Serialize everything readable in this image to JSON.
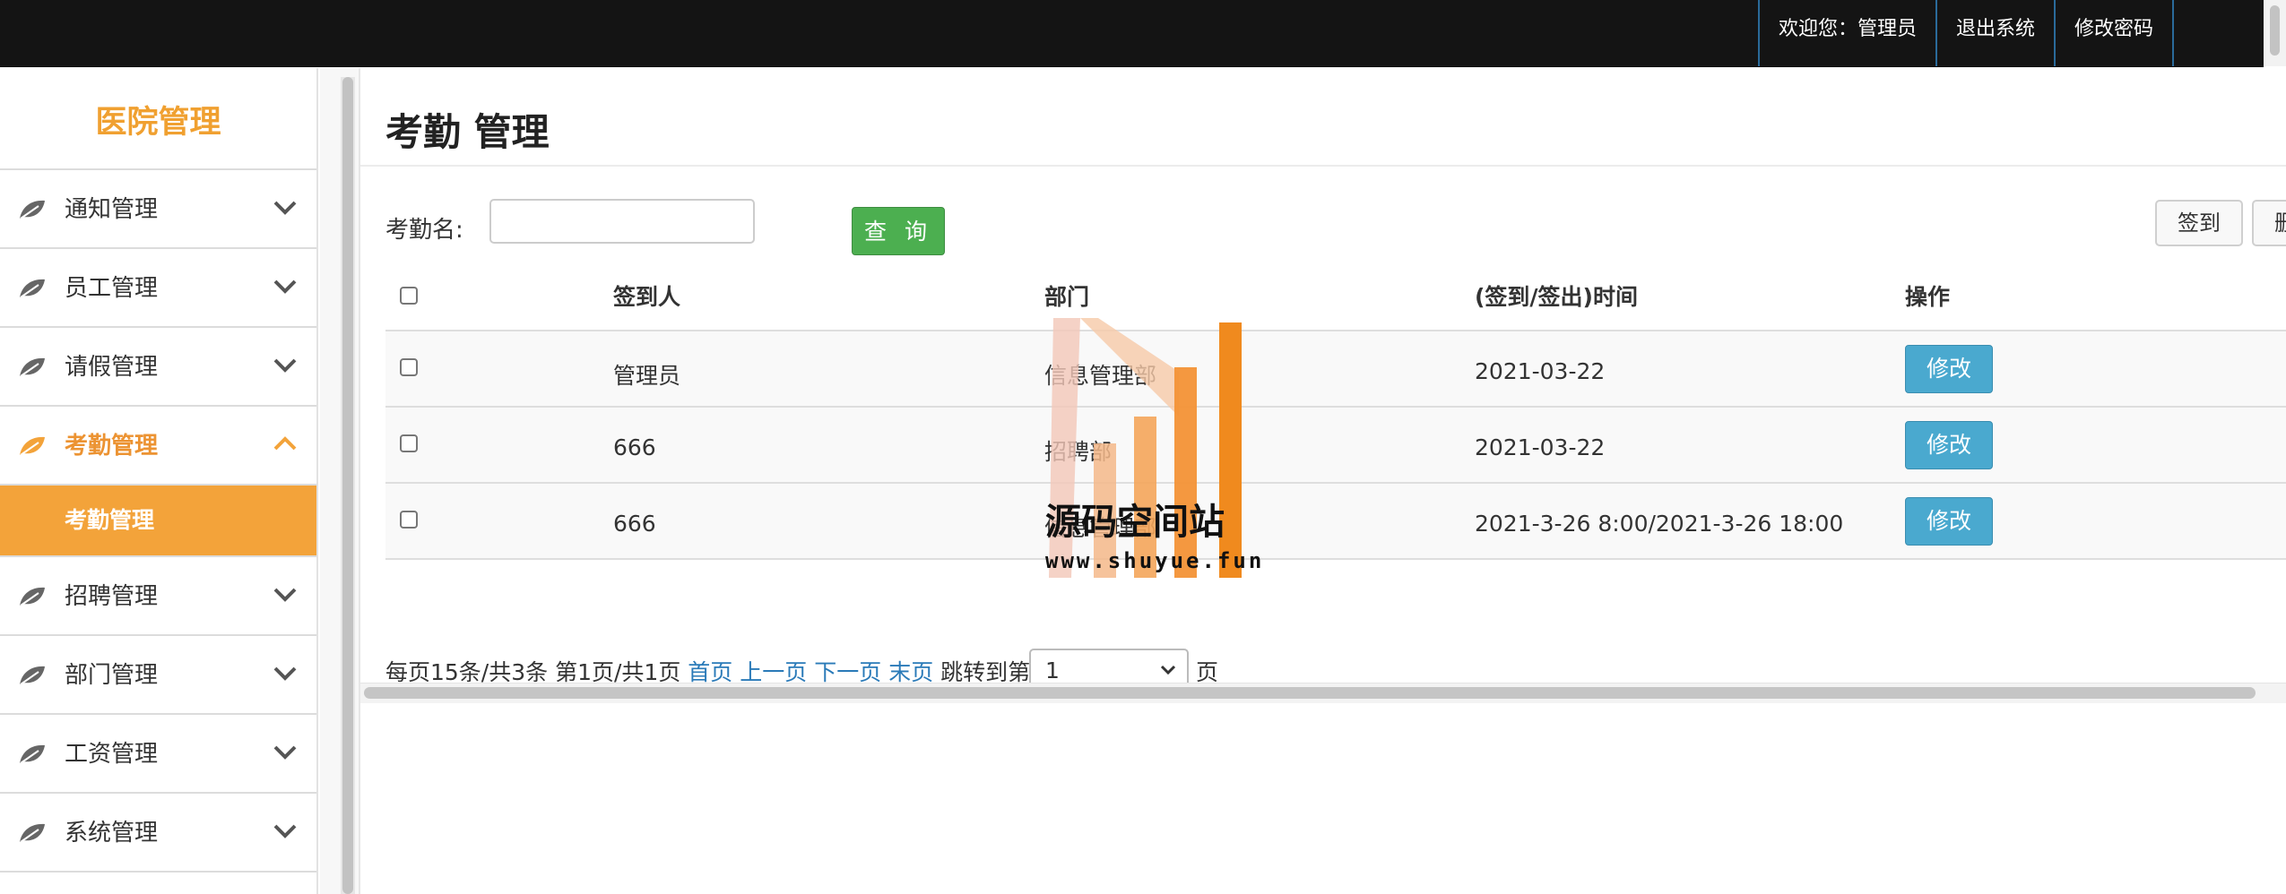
{
  "topbar": {
    "welcome": "欢迎您：管理员",
    "logout": "退出系统",
    "change_password": "修改密码"
  },
  "sidebar": {
    "brand": "医院管理",
    "items": [
      {
        "label": "通知管理",
        "icon": "leaf-icon",
        "expanded": false
      },
      {
        "label": "员工管理",
        "icon": "leaf-icon",
        "expanded": false
      },
      {
        "label": "请假管理",
        "icon": "leaf-icon",
        "expanded": false
      },
      {
        "label": "考勤管理",
        "icon": "leaf-icon",
        "expanded": true
      },
      {
        "label": "招聘管理",
        "icon": "leaf-icon",
        "expanded": false
      },
      {
        "label": "部门管理",
        "icon": "leaf-icon",
        "expanded": false
      },
      {
        "label": "工资管理",
        "icon": "leaf-icon",
        "expanded": false
      },
      {
        "label": "系统管理",
        "icon": "leaf-icon",
        "expanded": false
      }
    ],
    "submenu": {
      "label": "考勤管理"
    }
  },
  "main": {
    "title": "考勤 管理",
    "search": {
      "label": "考勤名:",
      "value": "",
      "button": "查 询"
    },
    "actions": {
      "sign": "签到",
      "delete": "删除"
    },
    "table": {
      "headers": [
        "签到人",
        "部门",
        "(签到/签出)时间",
        "操作"
      ],
      "rows": [
        {
          "person": "管理员",
          "dept": "信息管理部",
          "time": "2021-03-22",
          "action": "修改"
        },
        {
          "person": "666",
          "dept": "招聘部",
          "time": "2021-03-22",
          "action": "修改"
        },
        {
          "person": "666",
          "dept": "信息管理部",
          "time": "2021-3-26 8:00/2021-3-26 18:00",
          "action": "修改"
        }
      ]
    },
    "pager": {
      "summary": "每页15条/共3条 第1页/共1页",
      "first": "首页",
      "prev": "上一页",
      "next": "下一页",
      "last": "末页",
      "jump": "跳转到第",
      "selected_page": "1",
      "suffix": "页"
    }
  },
  "watermark": {
    "title": "源码空间站",
    "url": "www.shuyue.fun"
  },
  "colors": {
    "accent": "#f3a33a",
    "brand": "#f0a030",
    "query_button": "#4caf50",
    "edit_button": "#4aa9cf",
    "topbar": "#141414"
  }
}
